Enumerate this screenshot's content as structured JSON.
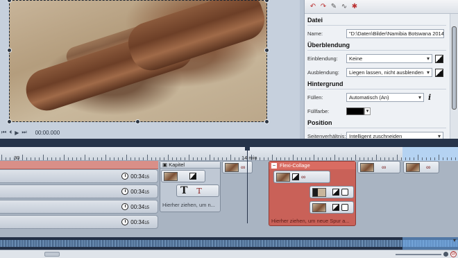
{
  "preview": {
    "timecode": "00:00.000"
  },
  "panel": {
    "file_section": "Datei",
    "name_label": "Name:",
    "name_value": "\"D:\\Daten\\Bilder\\Namibia Botswana 2014",
    "blend_section": "Überblendung",
    "fade_in_label": "Einblendung:",
    "fade_in_value": "Keine",
    "fade_out_label": "Ausblendung:",
    "fade_out_value": "Liegen lassen, nicht ausblenden",
    "bg_section": "Hintergrund",
    "fill_label": "Füllen:",
    "fill_value": "Automatisch (An)",
    "fillcolor_label": "Füllfarbe:",
    "fillcolor_value": "#000000",
    "position_section": "Position",
    "aspect_label": "Seitenverhältnis:",
    "aspect_value": "Intelligent zuschneiden"
  },
  "timeline": {
    "ruler_left": "30",
    "ruler_mid": "14 min",
    "tracks": [
      {
        "duration": "00:34",
        "frames": "15"
      },
      {
        "duration": "00:34",
        "frames": "15"
      },
      {
        "duration": "00:34",
        "frames": "15"
      },
      {
        "duration": "00:34",
        "frames": "15"
      }
    ],
    "chapter_title": "Kapitel",
    "chapter_placeholder": "Hierher ziehen, um n...",
    "flexi_title": "Flexi-Collage",
    "flexi_placeholder": "Hierher ziehen, um neue Spur a..."
  }
}
